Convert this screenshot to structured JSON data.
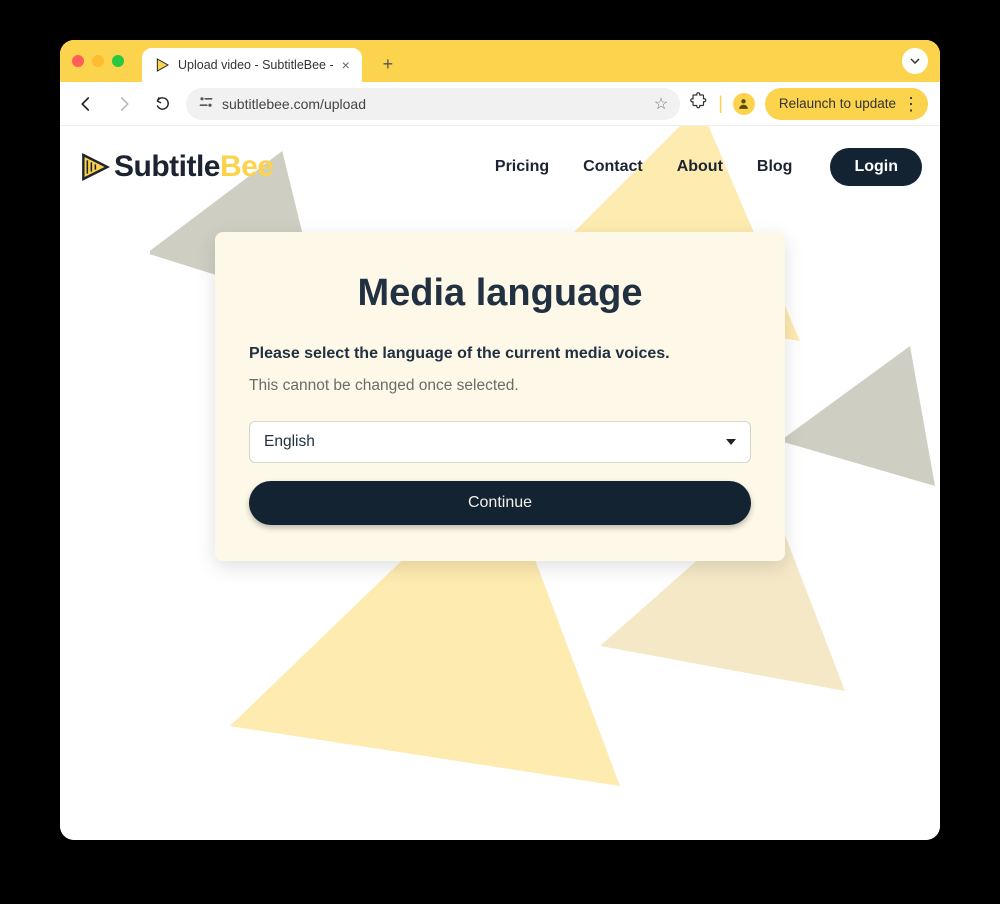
{
  "browser": {
    "tab_title": "Upload video - SubtitleBee - ",
    "url": "subtitlebee.com/upload",
    "relaunch_label": "Relaunch to update"
  },
  "header": {
    "brand_main": "Subtitle",
    "brand_accent": "Bee",
    "nav": {
      "pricing": "Pricing",
      "contact": "Contact",
      "about": "About",
      "blog": "Blog",
      "login": "Login"
    }
  },
  "modal": {
    "title": "Media language",
    "instruction": "Please select the language of the current media voices.",
    "note": "This cannot be changed once selected.",
    "selected_language": "English",
    "continue_label": "Continue"
  },
  "colors": {
    "accent": "#fcd34d",
    "dark": "#132332",
    "card_bg": "#fdf8e7"
  }
}
